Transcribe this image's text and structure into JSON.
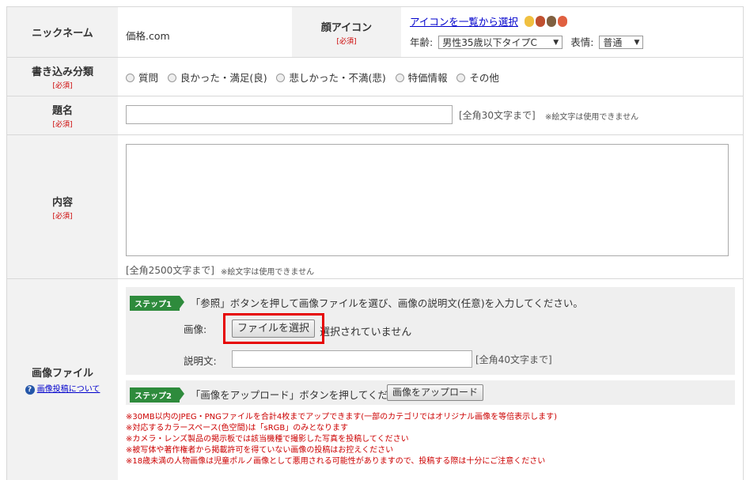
{
  "nickname": {
    "label": "ニックネーム",
    "value": "価格.com"
  },
  "icon": {
    "label": "顔アイコン",
    "required": "[必須]",
    "select_link": "アイコンを一覧から選択",
    "age_label": "年齢:",
    "age_value": "男性35歳以下タイプC",
    "expression_label": "表情:",
    "expression_value": "普通"
  },
  "category": {
    "label": "書き込み分類",
    "required": "[必須]",
    "options": [
      "質問",
      "良かった・満足(良)",
      "悲しかった・不満(悲)",
      "特価情報",
      "その他"
    ]
  },
  "title": {
    "label": "題名",
    "required": "[必須]",
    "limit": "[全角30文字まで]",
    "emoji_note": "※絵文字は使用できません"
  },
  "content": {
    "label": "内容",
    "required": "[必須]",
    "limit": "[全角2500文字まで]",
    "emoji_note": "※絵文字は使用できません"
  },
  "image": {
    "label": "画像ファイル",
    "help_link": "画像投稿について",
    "step1_badge": "ステップ1",
    "step1_text": "「参照」ボタンを押して画像ファイルを選び、画像の説明文(任意)を入力してください。",
    "image_label": "画像:",
    "file_button": "ファイルを選択",
    "file_status": "選択されていません",
    "desc_label": "説明文:",
    "desc_limit": "[全角40文字まで]",
    "step2_badge": "ステップ2",
    "step2_text": "「画像をアップロード」ボタンを押してください。",
    "upload_button": "画像をアップロード",
    "notes": [
      "※30MB以内のJPEG・PNGファイルを合計4枚までアップできます(一部のカテゴリではオリジナル画像を等倍表示します)",
      "※対応するカラースペース(色空間)は「sRGB」のみとなります",
      "※カメラ・レンズ製品の掲示板では該当機種で撮影した写真を投稿してください",
      "※被写体や著作権者から掲載許可を得ていない画像の投稿はお控えください",
      "※18歳未満の人物画像は児童ポルノ画像として悪用される可能性がありますので、投稿する際は十分にご注意ください"
    ]
  },
  "colors": {
    "required": "#cc0000",
    "step": "#2e8b3c",
    "highlight": "#e60000",
    "link": "#0000cc"
  }
}
